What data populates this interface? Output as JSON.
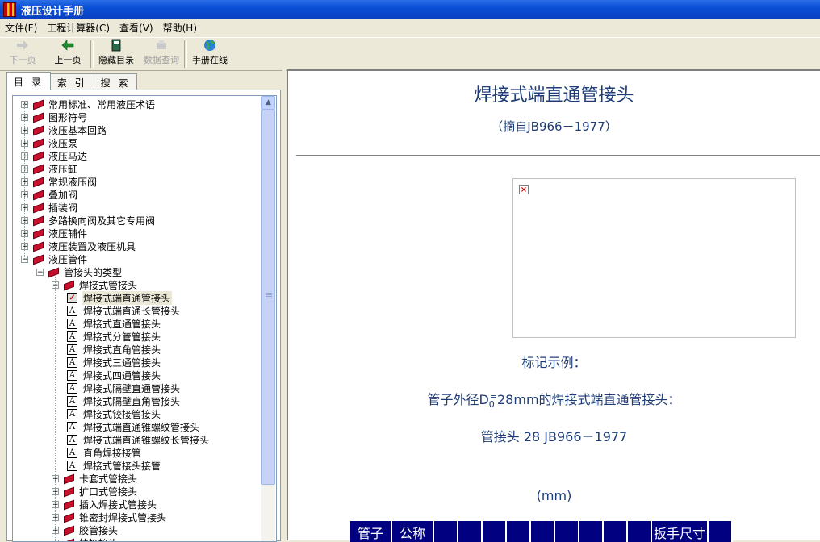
{
  "window": {
    "title": "液压设计手册"
  },
  "menu": [
    "文件(F)",
    "工程计算器(C)",
    "查看(V)",
    "帮助(H)"
  ],
  "toolbar": {
    "next": "下一页",
    "prev": "上一页",
    "hide_toc": "隐藏目录",
    "data_query": "数据查询",
    "online": "手册在线"
  },
  "tabs": [
    "目 录",
    "索 引",
    "搜 索"
  ],
  "tree": {
    "top": [
      "常用标准、常用液压术语",
      "图形符号",
      "液压基本回路",
      "液压泵",
      "液压马达",
      "液压缸",
      "常规液压阀",
      "叠加阀",
      "插装阀",
      "多路换向阀及其它专用阀",
      "液压辅件",
      "液压装置及液压机具",
      "液压管件"
    ],
    "sub": "管接头的类型",
    "subsub": "焊接式管接头",
    "pages": [
      "焊接式端直通管接头",
      "焊接式端直通长管接头",
      "焊接式直通管接头",
      "焊接式分管管接头",
      "焊接式直角管接头",
      "焊接式三通管接头",
      "焊接式四通管接头",
      "焊接式隔壁直通管接头",
      "焊接式隔壁直角管接头",
      "焊接式铰接管接头",
      "焊接式端直通锥螺纹管接头",
      "焊接式端直通锥螺纹长管接头",
      "直角焊接接管",
      "焊接式管接头接管"
    ],
    "siblings": [
      "卡套式管接头",
      "扩口式管接头",
      "插入焊接式管接头",
      "锥密封焊接式管接头",
      "胶管接头",
      "快换接头"
    ]
  },
  "doc": {
    "title": "焊接式端直通管接头",
    "subtitle": "（摘自JB966－1977）",
    "mark_label": "标记示例：",
    "example_pre": "管子外径D",
    "example_sub": "0",
    "example_sup": "=",
    "example_post": "28mm的焊接式端直通管接头：",
    "example_code": "管接头 28 JB966－1977",
    "unit": "(mm)",
    "table_headers": [
      "管子",
      "公称",
      "",
      "",
      "",
      "",
      "",
      "",
      "",
      "",
      "",
      "扳手尺寸",
      ""
    ]
  }
}
